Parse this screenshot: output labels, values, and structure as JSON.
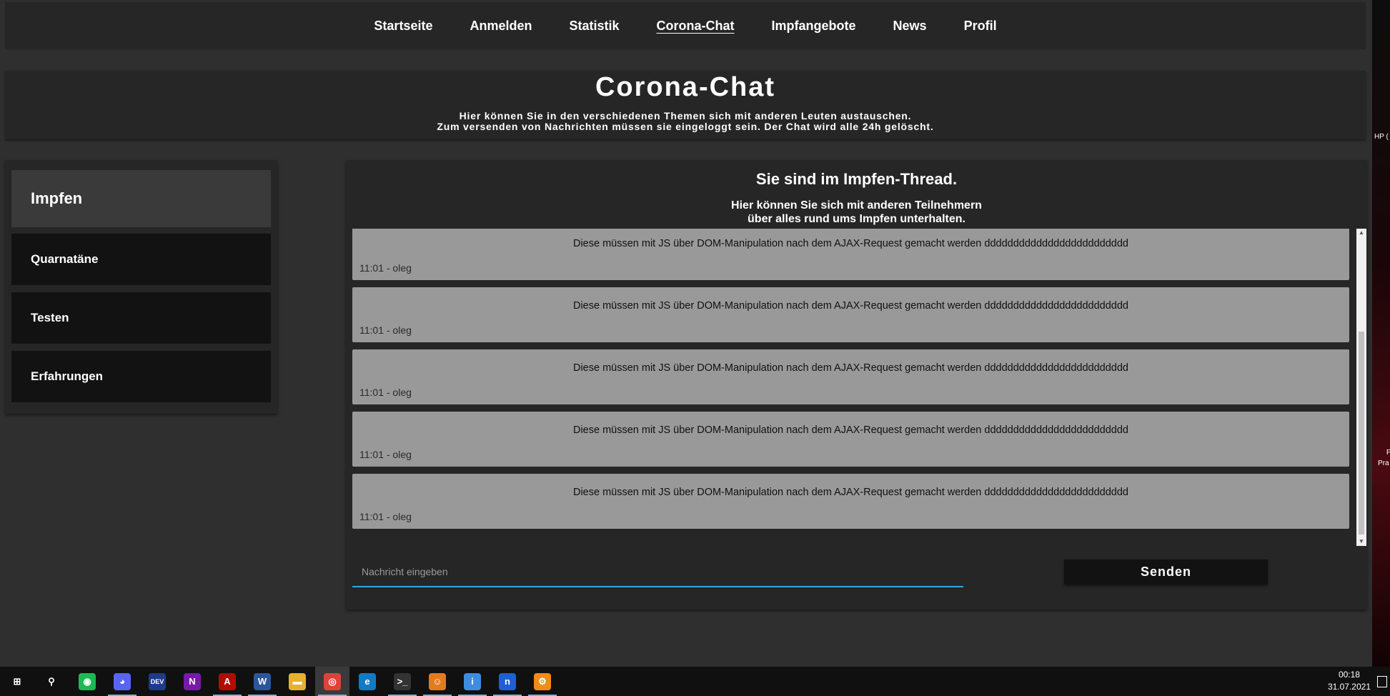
{
  "nav": {
    "items": [
      {
        "label": "Startseite"
      },
      {
        "label": "Anmelden"
      },
      {
        "label": "Statistik"
      },
      {
        "label": "Corona-Chat",
        "active": true
      },
      {
        "label": "Impfangebote"
      },
      {
        "label": "News"
      },
      {
        "label": "Profil"
      }
    ]
  },
  "banner": {
    "title": "Corona-Chat",
    "line1": "Hier können Sie in den verschiedenen Themen sich mit anderen Leuten austauschen.",
    "line2": "Zum versenden von Nachrichten müssen sie eingeloggt sein. Der Chat wird alle 24h gelöscht."
  },
  "sidebar": {
    "items": [
      {
        "label": "Impfen",
        "active": true
      },
      {
        "label": "Quarnatäne"
      },
      {
        "label": "Testen"
      },
      {
        "label": "Erfahrungen"
      }
    ]
  },
  "chat": {
    "title": "Sie sind im Impfen-Thread.",
    "sub1": "Hier können Sie sich mit anderen Teilnehmern",
    "sub2": "über alles rund ums Impfen unterhalten.",
    "messages": [
      {
        "text": "Diese müssen mit JS über DOM-Manipulation nach dem AJAX-Request gemacht werden ddddddddddddddddddddddddd",
        "meta": "11:01 - oleg"
      },
      {
        "text": "Diese müssen mit JS über DOM-Manipulation nach dem AJAX-Request gemacht werden ddddddddddddddddddddddddd",
        "meta": "11:01 - oleg"
      },
      {
        "text": "Diese müssen mit JS über DOM-Manipulation nach dem AJAX-Request gemacht werden ddddddddddddddddddddddddd",
        "meta": "11:01 - oleg"
      },
      {
        "text": "Diese müssen mit JS über DOM-Manipulation nach dem AJAX-Request gemacht werden ddddddddddddddddddddddddd",
        "meta": "11:01 - oleg"
      },
      {
        "text": "Diese müssen mit JS über DOM-Manipulation nach dem AJAX-Request gemacht werden ddddddddddddddddddddddddd",
        "meta": "11:01 - oleg"
      }
    ],
    "input_placeholder": "Nachricht eingeben",
    "input_value": "",
    "send_label": "Senden",
    "accent_color": "#2ca9e1"
  },
  "desktop": {
    "edge_text1": "HP (",
    "edge_text2": "P",
    "edge_text3": "Pra"
  },
  "taskbar": {
    "icons": [
      {
        "name": "windows-start-icon",
        "glyph": "⊞",
        "color": "#101010"
      },
      {
        "name": "search-icon",
        "glyph": "⚲",
        "color": "#101010"
      },
      {
        "name": "spotify-icon",
        "glyph": "◉",
        "color": "#1db954"
      },
      {
        "name": "discord-icon",
        "glyph": "◕",
        "color": "#5865f2"
      },
      {
        "name": "dev-icon",
        "glyph": "DEV",
        "color": "#1e3a8a"
      },
      {
        "name": "onenote-icon",
        "glyph": "N",
        "color": "#7719aa"
      },
      {
        "name": "acrobat-icon",
        "glyph": "A",
        "color": "#b30b00"
      },
      {
        "name": "word-icon",
        "glyph": "W",
        "color": "#2b579a"
      },
      {
        "name": "file-explorer-icon",
        "glyph": "▬",
        "color": "#e6b12e"
      },
      {
        "name": "chrome-icon",
        "glyph": "◎",
        "color": "#db4437"
      },
      {
        "name": "edge-icon",
        "glyph": "e",
        "color": "#0f7bc4"
      },
      {
        "name": "terminal-icon",
        "glyph": ">_",
        "color": "#333333"
      },
      {
        "name": "app-icon",
        "glyph": "☺",
        "color": "#e27a1f"
      },
      {
        "name": "info-app-icon",
        "glyph": "i",
        "color": "#3d8ce0"
      },
      {
        "name": "n-app-icon",
        "glyph": "n",
        "color": "#1f5fd6"
      },
      {
        "name": "share-app-icon",
        "glyph": "⚙",
        "color": "#f08c14"
      }
    ],
    "time": "00:18",
    "date": "31.07.2021"
  }
}
